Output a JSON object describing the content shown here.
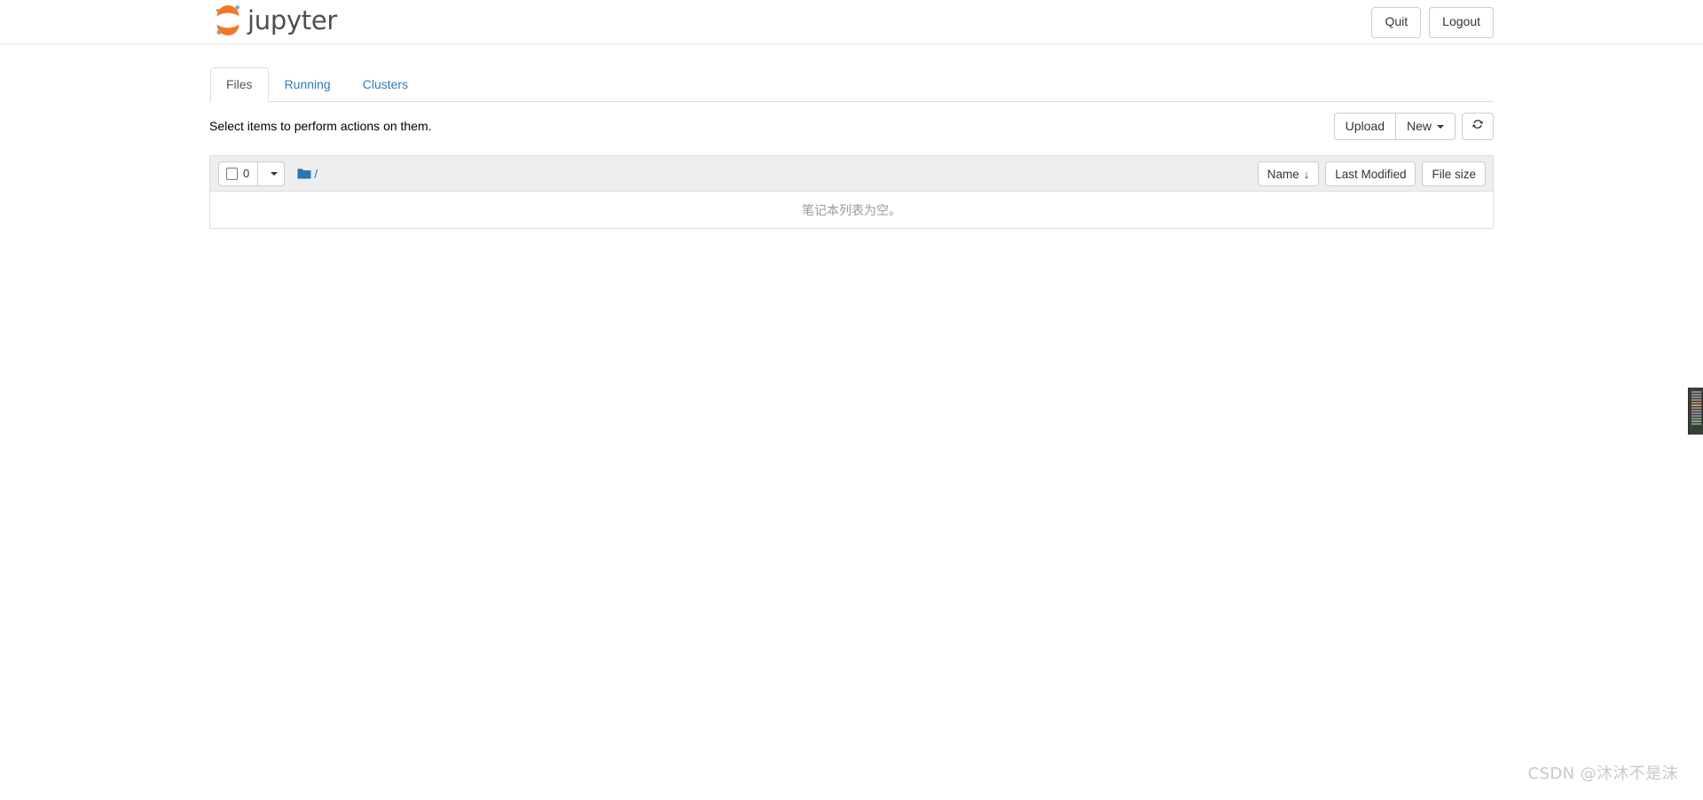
{
  "header": {
    "brand_text": "jupyter",
    "logo_icon": "jupyter-logo-icon",
    "buttons": [
      {
        "label": "Quit",
        "name": "quit-button"
      },
      {
        "label": "Logout",
        "name": "logout-button"
      }
    ]
  },
  "tabs": [
    {
      "label": "Files",
      "active": true
    },
    {
      "label": "Running",
      "active": false
    },
    {
      "label": "Clusters",
      "active": false
    }
  ],
  "notice": {
    "text": "Select items to perform actions on them."
  },
  "toolbar": {
    "upload_label": "Upload",
    "new_label": "New",
    "new_caret_icon": "chevron-down-icon",
    "refresh_icon": "refresh-icon",
    "refresh_glyph": "⟳"
  },
  "file_list": {
    "select_all_checkbox_icon": "checkbox-unchecked-icon",
    "selected_count": "0",
    "select_dropdown_icon": "chevron-down-icon",
    "folder_icon": "folder-icon",
    "breadcrumb_path": "/",
    "sort_buttons": [
      {
        "label": "Name",
        "arrow": "↓",
        "has_arrow": true,
        "name": "sort-by-name-button"
      },
      {
        "label": "Last Modified",
        "arrow": "",
        "has_arrow": false,
        "name": "sort-by-last-modified-button"
      },
      {
        "label": "File size",
        "arrow": "",
        "has_arrow": false,
        "name": "sort-by-file-size-button"
      }
    ],
    "empty_message": "笔记本列表为空。"
  },
  "watermark": {
    "text": "CSDN @沐沐不是沫"
  },
  "colors": {
    "brand_orange": "#f37726",
    "brand_gray": "#767677",
    "link_blue": "#337ab7",
    "folder_blue": "#2776b6",
    "toolbar_bg": "#eeeeee",
    "border_gray": "#dddddd",
    "empty_text": "#999999"
  },
  "minimap": {
    "name": "code-minimap-widget",
    "marks": [
      "gray",
      "gray",
      "gray",
      "gray",
      "gray",
      "orange",
      "gray",
      "gray",
      "gray",
      "gray",
      "gray",
      "green",
      "gray"
    ]
  }
}
